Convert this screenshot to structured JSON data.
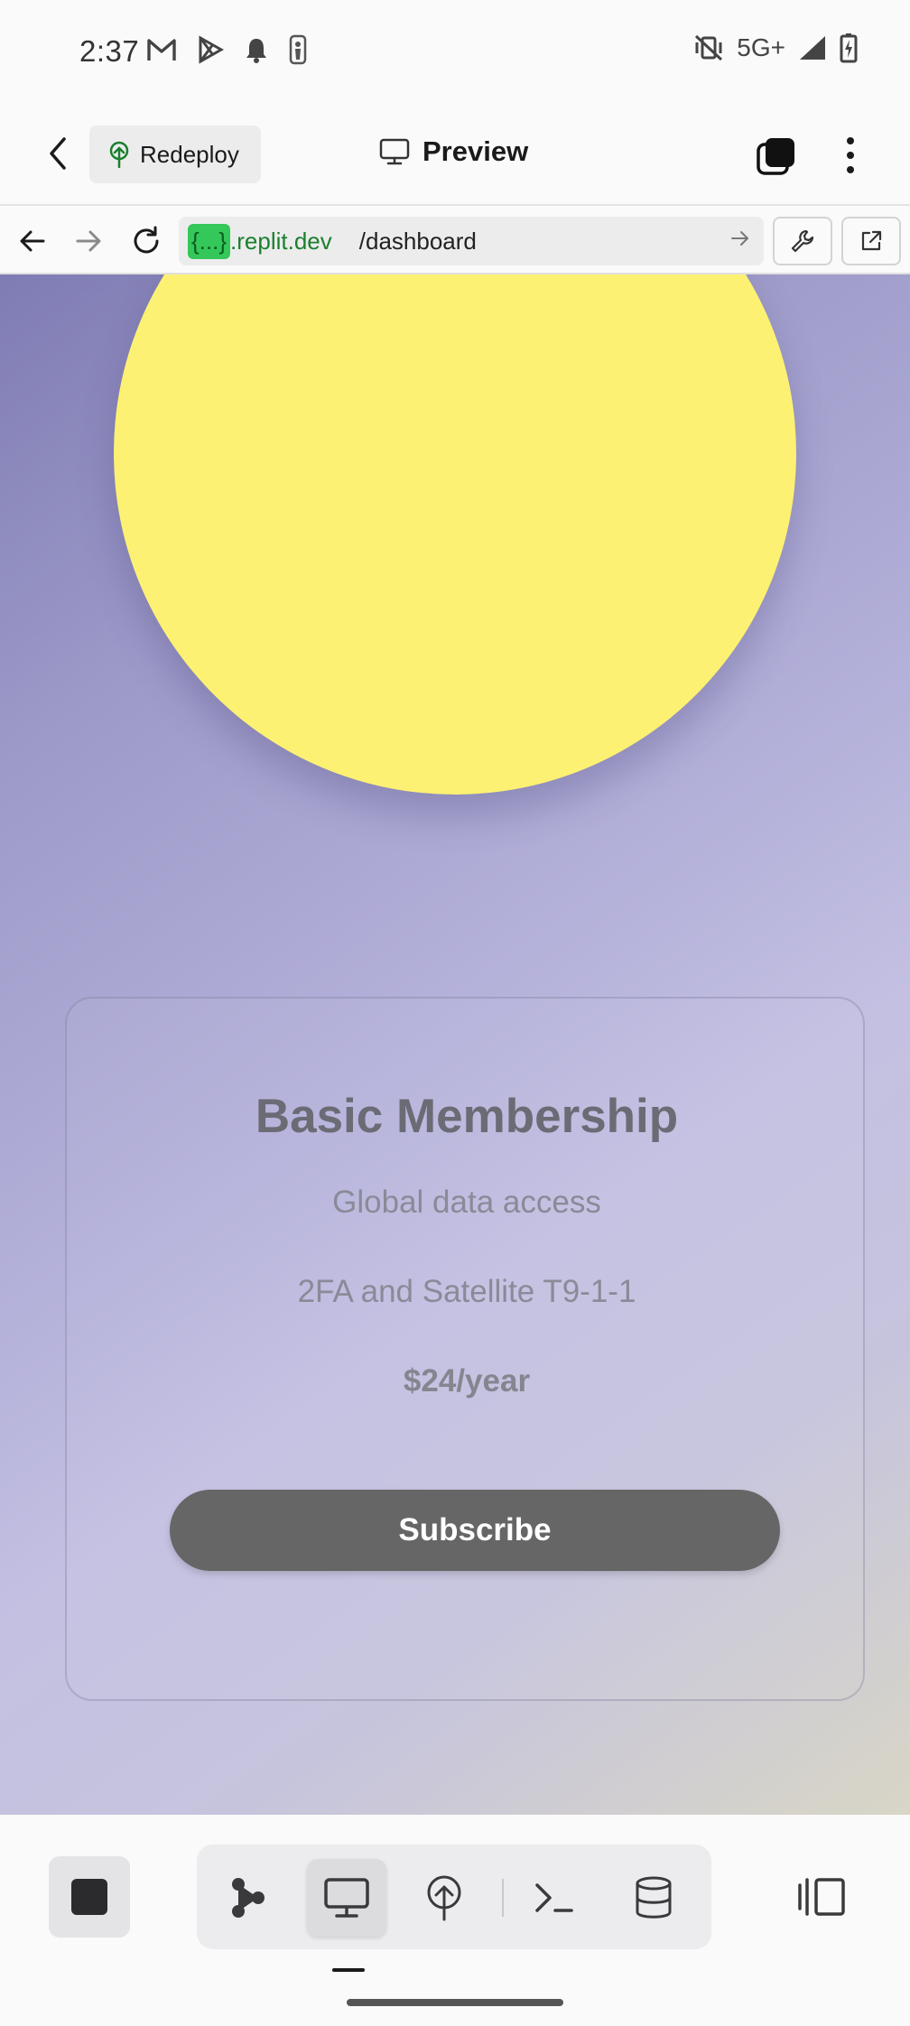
{
  "status_bar": {
    "time": "2:37",
    "network": "5G+",
    "icons_left": [
      "gmail-icon",
      "play-store-icon",
      "notification-bell-icon",
      "nba-icon"
    ],
    "icons_right": [
      "vibrate-off-icon",
      "signal-icon",
      "battery-charging-icon"
    ]
  },
  "header": {
    "redeploy_label": "Redeploy",
    "title": "Preview"
  },
  "url_bar": {
    "badge": "{...}",
    "domain": ".replit.dev",
    "path": "/dashboard"
  },
  "card": {
    "title": "Basic Membership",
    "feature_1": "Global data access",
    "feature_2": "2FA and Satellite T9-1-1",
    "price": "$24/year",
    "subscribe_label": "Subscribe"
  },
  "colors": {
    "sun": "#fdf173",
    "button": "#666666",
    "url_badge": "#34c759",
    "gradient_start": "#7f7cb4",
    "gradient_end": "#d8d6c6"
  },
  "bottom_toolbar": {
    "items": [
      "stop-icon",
      "agent-icon",
      "preview-icon",
      "deploy-icon",
      "shell-icon",
      "database-icon",
      "side-panel-icon"
    ],
    "active": "preview-icon"
  }
}
